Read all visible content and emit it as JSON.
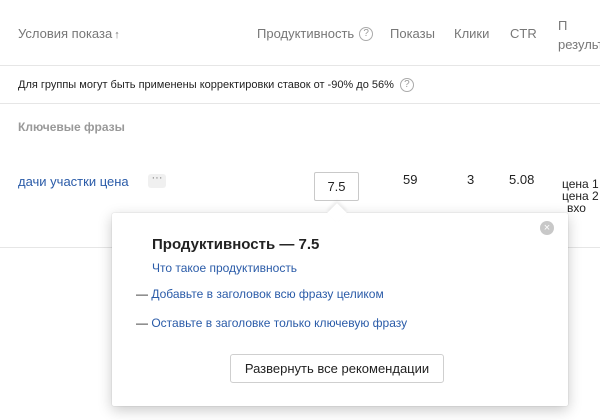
{
  "table_header": {
    "conditions": "Условия показа",
    "sort_arrow": "↑",
    "productivity": "Продуктивность",
    "help": "?",
    "impressions": "Показы",
    "clicks": "Клики",
    "ctr": "CTR",
    "result_line1": "П",
    "result_line2": "результ"
  },
  "notice": {
    "text": "Для группы могут быть применены корректировки ставок от -90% до 56%",
    "help": "?"
  },
  "group": {
    "title": "Ключевые фразы"
  },
  "row": {
    "phrase": "дачи участки цена",
    "more": "···",
    "productivity": "7.5",
    "impressions": "59",
    "clicks": "3",
    "ctr": "5.08",
    "price_1": "цена 1",
    "price_2": "цена 2",
    "price_3": "вхо"
  },
  "popup": {
    "close": "×",
    "title": "Продуктивность — 7.5",
    "what_is_link": "Что такое продуктивность",
    "recommendations": [
      {
        "dash": "—",
        "text": "Добавьте в заголовок всю фразу целиком"
      },
      {
        "dash": "—",
        "text": "Оставьте в заголовке только ключевую фразу"
      }
    ],
    "expand_button": "Развернуть все рекомендации"
  }
}
